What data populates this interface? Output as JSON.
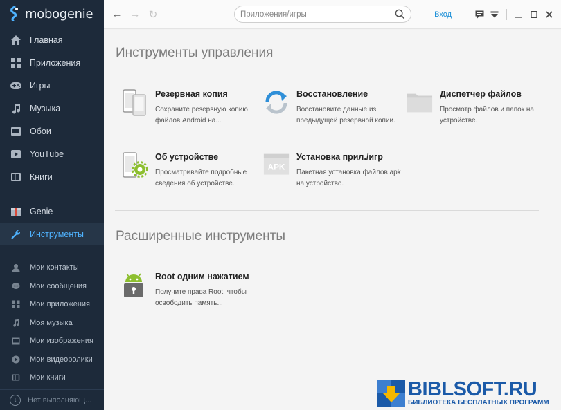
{
  "app": {
    "name": "mobogenie"
  },
  "sidebar": {
    "main_items": [
      {
        "label": "Главная",
        "icon": "home-icon"
      },
      {
        "label": "Приложения",
        "icon": "apps-grid-icon"
      },
      {
        "label": "Игры",
        "icon": "gamepad-icon"
      },
      {
        "label": "Музыка",
        "icon": "music-note-icon"
      },
      {
        "label": "Обои",
        "icon": "wallpaper-icon"
      },
      {
        "label": "YouTube",
        "icon": "youtube-icon"
      },
      {
        "label": "Книги",
        "icon": "book-icon"
      }
    ],
    "secondary_items": [
      {
        "label": "Genie",
        "icon": "gift-icon"
      },
      {
        "label": "Инструменты",
        "icon": "wrench-icon",
        "active": true
      }
    ],
    "my_items": [
      {
        "label": "Мои контакты",
        "icon": "contact-icon"
      },
      {
        "label": "Мои сообщения",
        "icon": "message-icon"
      },
      {
        "label": "Мои приложения",
        "icon": "apps-grid-icon"
      },
      {
        "label": "Моя музыка",
        "icon": "music-note-icon"
      },
      {
        "label": "Мои изображения",
        "icon": "image-icon"
      },
      {
        "label": "Мои видеоролики",
        "icon": "video-icon"
      },
      {
        "label": "Мои книги",
        "icon": "book-icon"
      }
    ],
    "footer": "Нет выполняющ..."
  },
  "topbar": {
    "search_placeholder": "Приложения/игры",
    "login": "Вход"
  },
  "content": {
    "section1_title": "Инструменты управления",
    "tools": [
      {
        "title": "Резервная копия",
        "desc": "Сохраните резервную копию файлов Android на...",
        "icon": "backup-phone-icon"
      },
      {
        "title": "Восстановление",
        "desc": "Восстановите данные из предыдущей резервной копии.",
        "icon": "restore-icon"
      },
      {
        "title": "Диспетчер файлов",
        "desc": "Просмотр файлов и папок на устройстве.",
        "icon": "folder-icon"
      },
      {
        "title": "Об устройстве",
        "desc": "Просматривайте подробные сведения об устройстве.",
        "icon": "device-info-icon"
      },
      {
        "title": "Установка прил./игр",
        "desc": "Пакетная установка файлов apk на устройство.",
        "icon": "apk-icon",
        "icon_text": "APK"
      }
    ],
    "section2_title": "Расширенные инструменты",
    "advanced_tools": [
      {
        "title": "Root одним нажатием",
        "desc": "Получите права Root, чтобы освободить память...",
        "icon": "android-lock-icon"
      }
    ]
  },
  "watermark": {
    "title": "BIBLSOFT.RU",
    "subtitle": "БИБЛИОТЕКА БЕСПЛАТНЫХ ПРОГРАММ"
  },
  "colors": {
    "sidebar_bg": "#1d2a3a",
    "accent": "#4fb3ff",
    "link": "#1a8fd8",
    "android_green": "#8dbf2f"
  }
}
